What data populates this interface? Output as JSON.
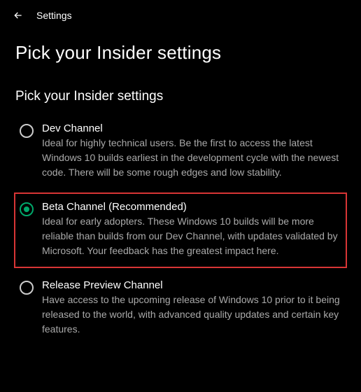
{
  "header": {
    "title": "Settings"
  },
  "page": {
    "heading": "Pick your Insider settings",
    "section_heading": "Pick your Insider settings"
  },
  "options": [
    {
      "title": "Dev Channel",
      "description": "Ideal for highly technical users. Be the first to access the latest Windows 10 builds earliest in the development cycle with the newest code. There will be some rough edges and low stability.",
      "selected": false,
      "highlighted": false
    },
    {
      "title": "Beta Channel (Recommended)",
      "description": "Ideal for early adopters. These Windows 10 builds will be more reliable than builds from our Dev Channel, with updates validated by Microsoft. Your feedback has the greatest impact here.",
      "selected": true,
      "highlighted": true
    },
    {
      "title": "Release Preview Channel",
      "description": "Have access to the upcoming release of Windows 10 prior to it being released to the world, with advanced quality updates and certain key features.",
      "selected": false,
      "highlighted": false
    }
  ]
}
